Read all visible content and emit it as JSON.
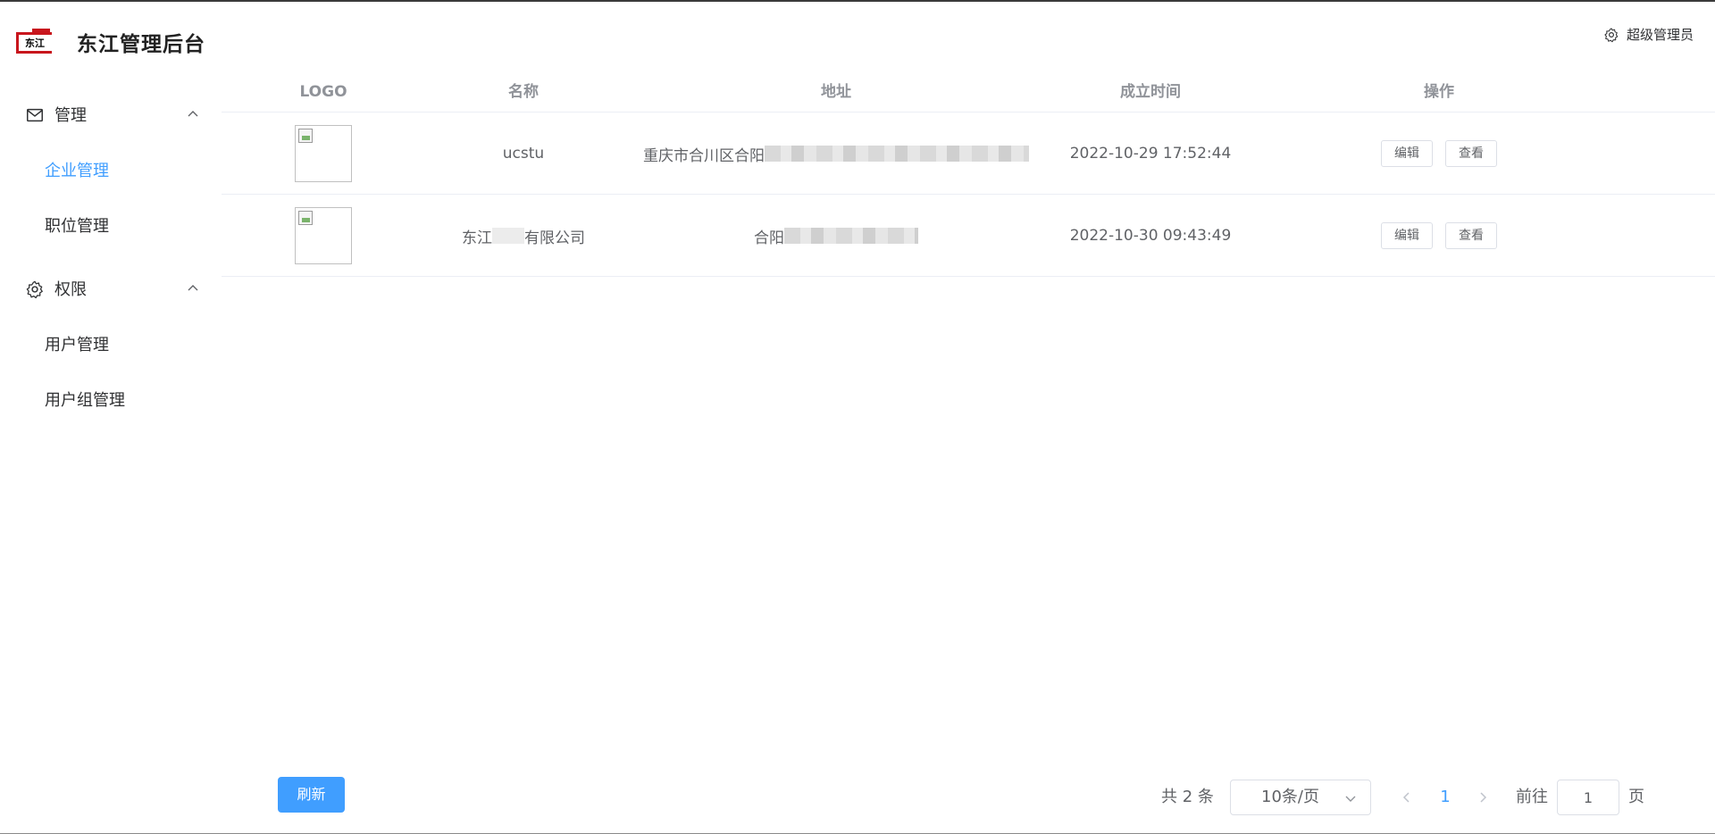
{
  "app": {
    "brand_logo_text": "东江",
    "title": "东江管理后台",
    "user_label": "超级管理员"
  },
  "sidebar": {
    "groups": [
      {
        "label": "管理",
        "icon": "mail-icon",
        "expanded": true,
        "items": [
          {
            "label": "企业管理",
            "active": true
          },
          {
            "label": "职位管理",
            "active": false
          }
        ]
      },
      {
        "label": "权限",
        "icon": "gear-icon",
        "expanded": true,
        "items": [
          {
            "label": "用户管理",
            "active": false
          },
          {
            "label": "用户组管理",
            "active": false
          }
        ]
      }
    ]
  },
  "table": {
    "columns": [
      "LOGO",
      "名称",
      "地址",
      "成立时间",
      "操作"
    ],
    "rows": [
      {
        "logo": "broken-image",
        "name": "ucstu",
        "address_visible": "重庆市合川区合阳",
        "established": "2022-10-29 17:52:44",
        "actions": [
          "编辑",
          "查看"
        ]
      },
      {
        "logo": "broken-image",
        "name_prefix": "东江",
        "name_suffix": "有限公司",
        "address_visible": "合阳",
        "established": "2022-10-30 09:43:49",
        "actions": [
          "编辑",
          "查看"
        ]
      }
    ]
  },
  "footer": {
    "refresh_label": "刷新",
    "total_text": "共 2 条",
    "page_size": "10条/页",
    "current_page": "1",
    "goto_label": "前往",
    "goto_value": "1",
    "page_unit": "页"
  },
  "colors": {
    "accent": "#409eff",
    "brand_red": "#c8161d"
  }
}
